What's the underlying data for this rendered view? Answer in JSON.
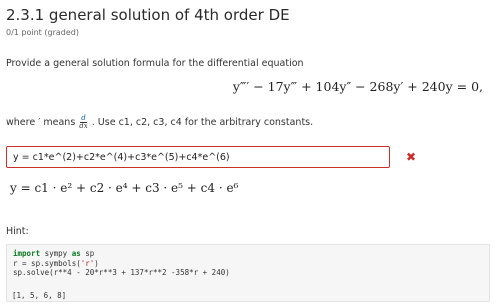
{
  "question": {
    "title": "2.3.1 general solution of 4th order DE",
    "points": "0/1 point (graded)",
    "prompt": "Provide a general solution formula for the differential equation",
    "equation": "y‴′ − 17y‴ + 104y″ − 268y′ + 240y = 0,",
    "where_prefix": "where ′ means",
    "fraction_num": "d",
    "fraction_den": "dx",
    "where_suffix": ". Use c1, c2, c3, c4 for the arbitrary constants."
  },
  "answer": {
    "value": "y = c1*e^(2)+c2*e^(4)+c3*e^(5)+c4*e^(6)",
    "status": "incorrect",
    "status_icon": "✖",
    "preview": "y = c1 · e² + c2 · e⁴ + c3 · e⁵ + c4 · e⁶"
  },
  "hint": {
    "label": "Hint:",
    "code": {
      "line1_kw1": "import",
      "line1_mid": " sympy ",
      "line1_kw2": "as",
      "line1_end": " sp",
      "line2_a": "r = sp.symbols(",
      "line2_str": "'r'",
      "line2_b": ")",
      "line3": "sp.solve(r**4 - 20*r**3 + 137*r**2 -358*r + 240)"
    },
    "output": "[1, 5, 6, 8]"
  },
  "colors": {
    "error": "#c9302c",
    "keyword": "#0a7a22"
  }
}
